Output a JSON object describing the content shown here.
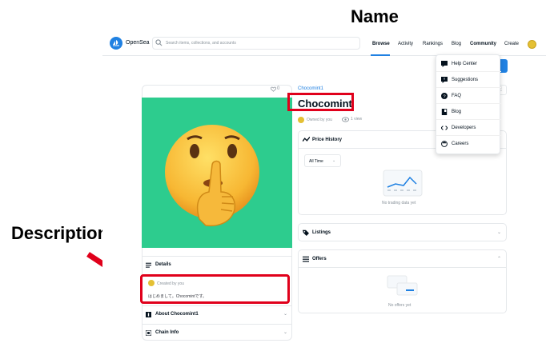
{
  "annotations": {
    "name_label": "Name",
    "description_label": "Description"
  },
  "header": {
    "brand": "OpenSea",
    "search_placeholder": "Search items, collections, and accounts",
    "nav": [
      "Browse",
      "Activity",
      "Rankings",
      "Blog",
      "Community",
      "Create"
    ]
  },
  "community_menu": [
    "Help Center",
    "Suggestions",
    "FAQ",
    "Blog",
    "Developers",
    "Careers"
  ],
  "item": {
    "favorites": "0",
    "collection": "Chocomint1",
    "name": "Chocomint",
    "owned_by": "Owned by you",
    "views": "1 view"
  },
  "left_panel": {
    "details_label": "Details",
    "created_by": "Created by you",
    "description": "はじめまして。Chocomintです。",
    "about_label": "About Chocomint1",
    "chain_label": "Chain Info"
  },
  "right_panel": {
    "price_history_label": "Price History",
    "time_filter": "All Time",
    "no_trading": "No trading data yet",
    "listings_label": "Listings",
    "offers_label": "Offers",
    "no_offers": "No offers yet"
  },
  "colors": {
    "accent": "#2081e2",
    "highlight": "#e0001b",
    "nft_background": "#2dcc8e"
  },
  "icons": [
    "opensea-logo-icon",
    "search-icon",
    "heart-icon",
    "eye-icon",
    "chart-icon",
    "tag-icon",
    "list-icon",
    "chevron-icon"
  ]
}
